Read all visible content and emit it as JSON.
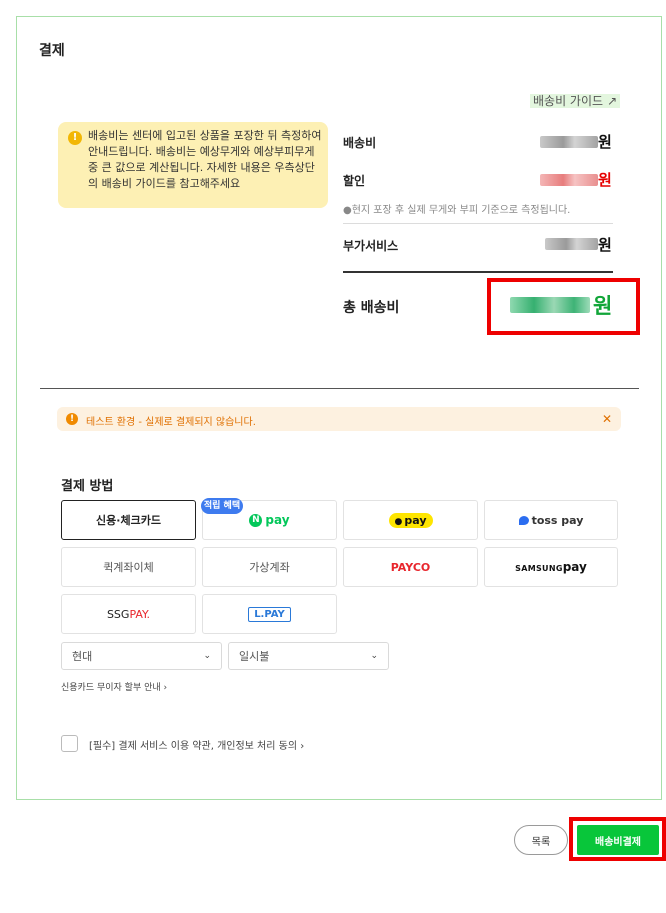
{
  "header": {
    "title": "결제"
  },
  "guide_link": {
    "label": "배송비 가이드",
    "arrow": "↗"
  },
  "tip": {
    "icon": "lightbulb-icon",
    "text": "배송비는 센터에 입고된 상품을 포장한 뒤 측정하여 안내드립니다. 배송비는 예상무게와 예상부피무게 중 큰 값으로 계산됩니다. 자세한 내용은 우측상단의 배송비 가이드를 참고해주세요"
  },
  "fees": {
    "shipping": {
      "label": "배송비",
      "unit": "원"
    },
    "discount": {
      "label": "할인",
      "unit": "원"
    },
    "note": "●현지 포장 후 실제 무게와 부피 기준으로 측정됩니다.",
    "addon": {
      "label": "부가서비스",
      "unit": "원"
    },
    "total": {
      "label": "총 배송비",
      "unit": "원"
    }
  },
  "warning": {
    "icon": "alert-icon",
    "text": "테스트 환경 - 실제로 결제되지 않습니다.",
    "close": "✕"
  },
  "payment": {
    "title": "결제 방법",
    "badge": "적립 혜택",
    "methods": {
      "card": "신용·체크카드",
      "npay_n": "N",
      "npay": "pay",
      "kakaopay": "pay",
      "tosspay": "toss pay",
      "transfer": "퀵계좌이체",
      "virtual": "가상계좌",
      "payco": "PAYCO",
      "samsung_brand": "SAMSUNG",
      "samsung_pay": "pay",
      "ssg_brand": "SSG",
      "ssg_pay": "PAY.",
      "lpay": "L.PAY"
    },
    "card_company": "현대",
    "installment": "일시불",
    "interest_free_link": "신용카드 무이자 할부 안내 ›"
  },
  "agreement": {
    "text": "[필수] 결제 서비스 이용 약관, 개인정보 처리 동의 ›"
  },
  "actions": {
    "list": "목록",
    "pay": "배송비결제"
  },
  "colors": {
    "accent_green": "#08c63a",
    "highlight_red": "#ee0000",
    "tip_yellow": "#fdf0b4"
  }
}
